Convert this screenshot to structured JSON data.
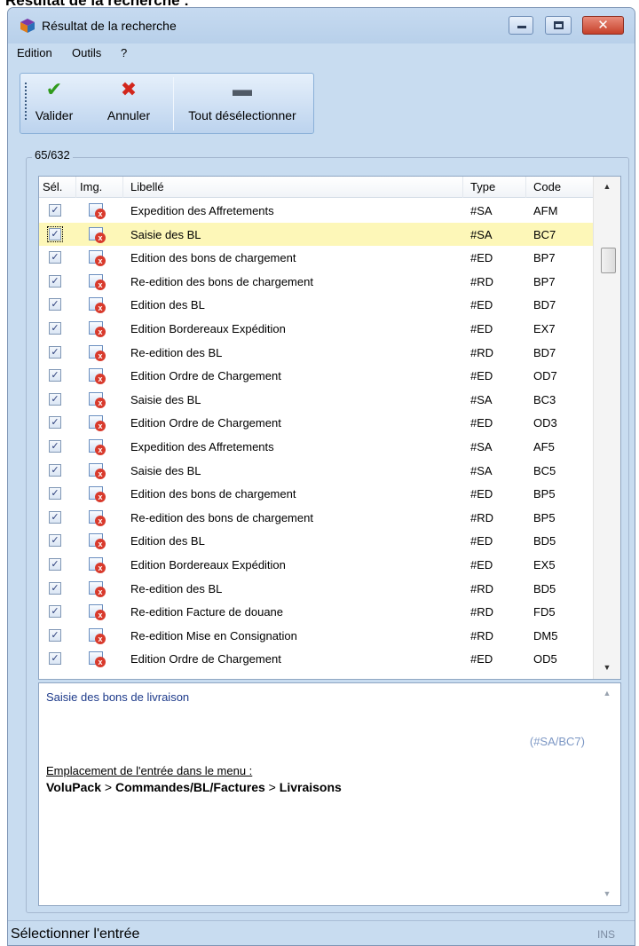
{
  "page_caption": "Résultat de la recherche :",
  "window": {
    "title": "Résultat de la recherche",
    "close_glyph": "✕"
  },
  "menu": [
    "Edition",
    "Outils",
    "?"
  ],
  "toolbar": {
    "validate_label": "Valider",
    "validate_glyph": "✔",
    "cancel_label": "Annuler",
    "cancel_glyph": "✖",
    "deselect_label": "Tout désélectionner",
    "deselect_glyph": "▬"
  },
  "group_label": "65/632",
  "grid": {
    "headers": {
      "sel": "Sél.",
      "img": "Img.",
      "label": "Libellé",
      "type": "Type",
      "code": "Code"
    },
    "rows": [
      {
        "checked": "✓",
        "label": "Expedition des Affretements",
        "type": "#SA",
        "code": "AFM"
      },
      {
        "checked": "✓",
        "label": "Saisie des BL",
        "type": "#SA",
        "code": "BC7"
      },
      {
        "checked": "✓",
        "label": "Edition des bons de chargement",
        "type": "#ED",
        "code": "BP7"
      },
      {
        "checked": "✓",
        "label": "Re-edition des bons de chargement",
        "type": "#RD",
        "code": "BP7"
      },
      {
        "checked": "✓",
        "label": "Edition des BL",
        "type": "#ED",
        "code": "BD7"
      },
      {
        "checked": "✓",
        "label": "Edition Bordereaux Expédition",
        "type": "#ED",
        "code": "EX7"
      },
      {
        "checked": "✓",
        "label": "Re-edition des BL",
        "type": "#RD",
        "code": "BD7"
      },
      {
        "checked": "✓",
        "label": "Edition Ordre de Chargement",
        "type": "#ED",
        "code": "OD7"
      },
      {
        "checked": "✓",
        "label": "Saisie des BL",
        "type": "#SA",
        "code": "BC3"
      },
      {
        "checked": "✓",
        "label": "Edition Ordre de Chargement",
        "type": "#ED",
        "code": "OD3"
      },
      {
        "checked": "✓",
        "label": "Expedition des Affretements",
        "type": "#SA",
        "code": "AF5"
      },
      {
        "checked": "✓",
        "label": "Saisie des BL",
        "type": "#SA",
        "code": "BC5"
      },
      {
        "checked": "✓",
        "label": "Edition des bons de chargement",
        "type": "#ED",
        "code": "BP5"
      },
      {
        "checked": "✓",
        "label": "Re-edition des bons de chargement",
        "type": "#RD",
        "code": "BP5"
      },
      {
        "checked": "✓",
        "label": "Edition des BL",
        "type": "#ED",
        "code": "BD5"
      },
      {
        "checked": "✓",
        "label": "Edition Bordereaux Expédition",
        "type": "#ED",
        "code": "EX5"
      },
      {
        "checked": "✓",
        "label": "Re-edition des BL",
        "type": "#RD",
        "code": "BD5"
      },
      {
        "checked": "✓",
        "label": "Re-edition Facture de douane",
        "type": "#RD",
        "code": "FD5"
      },
      {
        "checked": "✓",
        "label": "Re-edition Mise en Consignation",
        "type": "#RD",
        "code": "DM5"
      },
      {
        "checked": "✓",
        "label": "Edition Ordre de Chargement",
        "type": "#ED",
        "code": "OD5"
      }
    ],
    "selected_index": 1,
    "scroll_up_glyph": "▲",
    "scroll_down_glyph": "▼"
  },
  "detail": {
    "description": "Saisie des bons de livraison",
    "code": "(#SA/BC7)",
    "location_label": "Emplacement de l'entrée dans le menu :",
    "path_root": "VoluPack",
    "path_sep_1": " > ",
    "path_mid": "Commandes/BL/Factures",
    "path_sep_2": " > ",
    "path_leaf": "Livraisons"
  },
  "status": {
    "text": "Sélectionner l'entrée",
    "ins": "INS"
  },
  "colors": {
    "window_bg": "#c8dcf0",
    "selected_row": "#fdf7b8",
    "validate_green": "#2f9a1c",
    "cancel_red": "#d2261c",
    "description_blue": "#1d3a8a"
  }
}
